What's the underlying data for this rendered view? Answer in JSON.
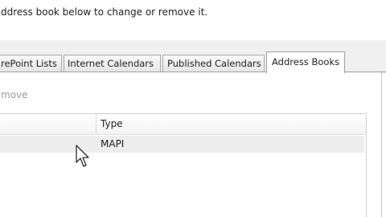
{
  "instruction": "ddress book below to change or remove it.",
  "tabs": [
    {
      "label": "rePoint Lists"
    },
    {
      "label": "Internet Calendars"
    },
    {
      "label": "Published Calendars"
    },
    {
      "label": "Address Books",
      "active": true
    }
  ],
  "toolbar": {
    "remove_label": "move"
  },
  "list": {
    "columns": [
      "",
      "Type"
    ],
    "rows": [
      {
        "name": "",
        "type": "MAPI",
        "selected": true
      }
    ]
  },
  "icons": {
    "cursor": "arrow-cursor-icon"
  },
  "colors": {
    "tab_band": "#f0f0f0",
    "selected_row": "#ededed",
    "disabled_text": "#9a9a9a"
  }
}
